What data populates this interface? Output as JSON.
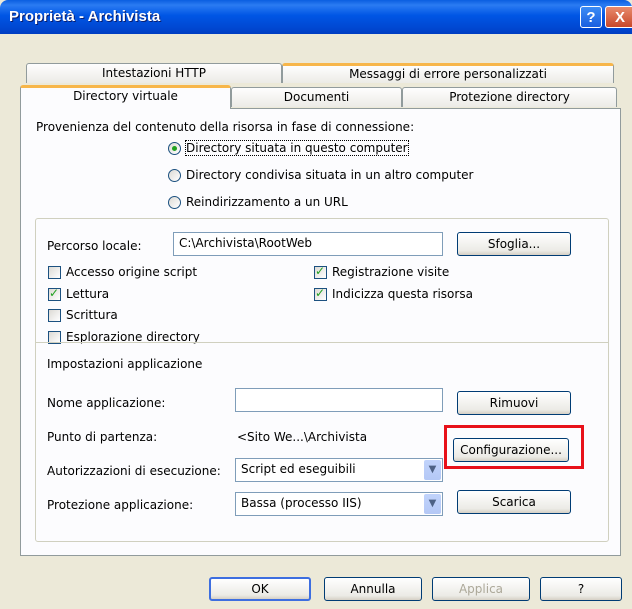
{
  "window": {
    "title": "Proprietà - Archivista",
    "help_glyph": "?",
    "close_glyph": "X"
  },
  "tabs": {
    "row_back": [
      "Intestazioni HTTP",
      "Messaggi di errore personalizzati"
    ],
    "row_front": [
      "Directory virtuale",
      "Documenti",
      "Protezione directory"
    ],
    "active": "Directory virtuale"
  },
  "source": {
    "heading": "Provenienza del contenuto della risorsa in fase di connessione:",
    "options": [
      {
        "label": "Directory situata in questo computer",
        "selected": true
      },
      {
        "label": "Directory condivisa situata in un altro computer",
        "selected": false
      },
      {
        "label": "Reindirizzamento a un URL",
        "selected": false
      }
    ]
  },
  "local_path": {
    "label": "Percorso locale:",
    "value": "C:\\Archivista\\RootWeb",
    "browse_button": "Sfoglia..."
  },
  "checkboxes": {
    "left": [
      {
        "label": "Accesso origine script",
        "checked": false
      },
      {
        "label": "Lettura",
        "checked": true
      },
      {
        "label": "Scrittura",
        "checked": false
      },
      {
        "label": "Esplorazione directory",
        "checked": false
      }
    ],
    "right": [
      {
        "label": "Registrazione visite",
        "checked": true
      },
      {
        "label": "Indicizza questa risorsa",
        "checked": true
      }
    ]
  },
  "app_settings": {
    "heading": "Impostazioni applicazione",
    "name_label": "Nome applicazione:",
    "name_value": "",
    "remove_button": "Rimuovi",
    "start_label": "Punto di partenza:",
    "start_value": "<Sito We...\\Archivista",
    "config_button": "Configurazione...",
    "exec_label": "Autorizzazioni di esecuzione:",
    "exec_value": "Script ed eseguibili",
    "protection_label": "Protezione applicazione:",
    "protection_value": "Bassa (processo IIS)",
    "unload_button": "Scarica"
  },
  "footer": {
    "ok": "OK",
    "cancel": "Annulla",
    "apply": "Applica",
    "help": "?"
  }
}
